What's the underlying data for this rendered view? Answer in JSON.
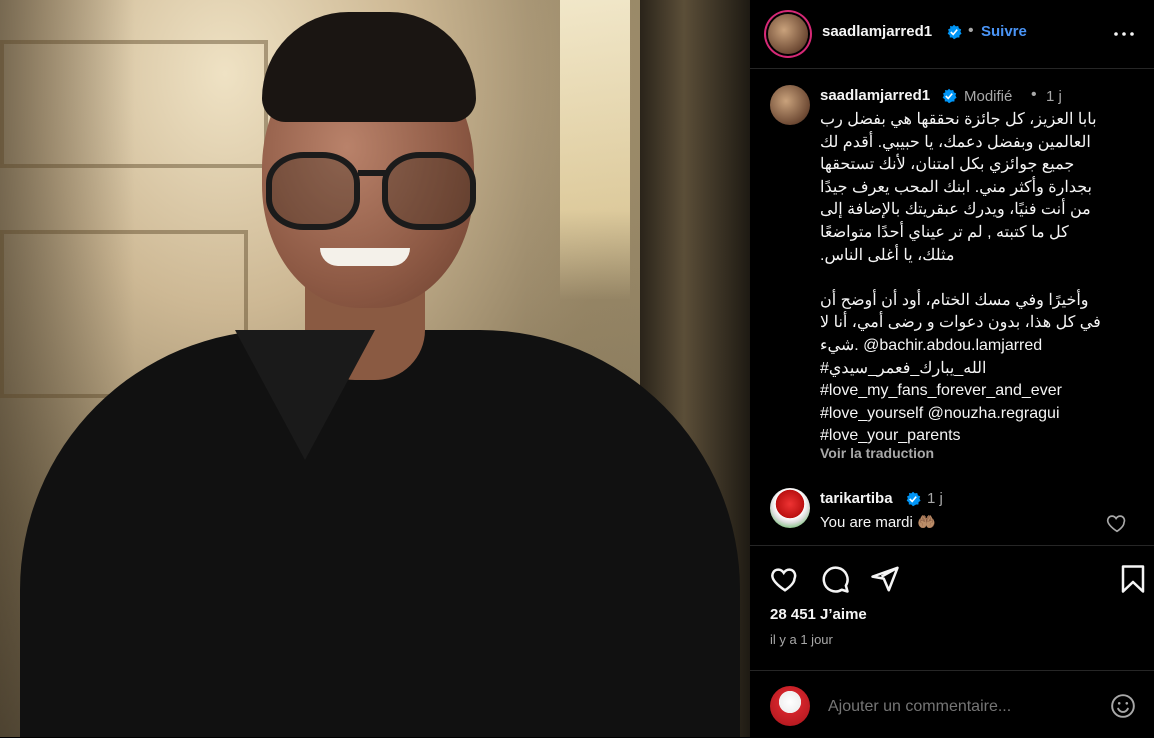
{
  "post": {
    "author": "saadlamjarred1",
    "follow_label": "Suivre",
    "separator": "•",
    "caption": {
      "author": "saadlamjarred1",
      "edited_label": "Modifié",
      "time": "1 j",
      "text": "بابا العزيز، كل جائزة نحققها هي بفضل رب\nالعالمين وبفضل دعمك، يا حبيبي. أقدم لك\nجميع جوائزي بكل امتنان، لأنك تستحقها\nبجدارة وأكثر مني. ابنك المحب يعرف جيدًا\nمن أنت فنيًا، ويدرك عبقريتك بالإضافة إلى\nكل ما كتبته , لم تر عيناي أحدًا متواضعًا\n.مثلك، يا أغلى الناس\n\nوأخيرًا وفي مسك الختام، أود أن أوضح أن\nفي كل هذا، بدون دعوات و رضى أمي، أنا لا\nشيء. @bachir.abdou.lamjarred\n#الله_يبارك_فعمر_سيدي\n#love_my_fans_forever_and_ever\n#love_yourself @nouzha.regragui\n#love_your_parents",
      "translate_label": "Voir la traduction"
    },
    "comment": {
      "author": "tarikartiba",
      "time": "1 j",
      "text": "You are mardi 🤲🏽"
    },
    "likes": "28 451 J’aime",
    "posted_ago": "il y a 1 jour",
    "add_comment_placeholder": "Ajouter un commentaire..."
  },
  "colors": {
    "background": "#000000",
    "accent": "#4a94f5",
    "muted_text": "#a8a8a8",
    "divider": "#262626"
  },
  "icons": [
    "more-options-icon",
    "verified-badge-icon",
    "heart-icon",
    "comment-icon",
    "share-icon",
    "bookmark-icon",
    "emoji-icon"
  ]
}
